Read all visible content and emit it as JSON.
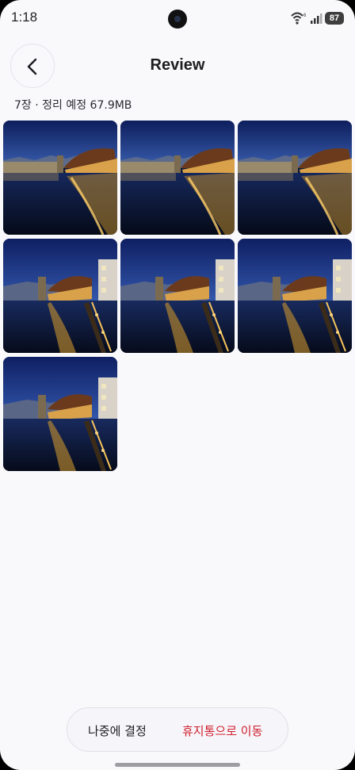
{
  "status_bar": {
    "time": "1:18",
    "battery": "87"
  },
  "header": {
    "back_label": "Back",
    "title": "Review"
  },
  "summary": "7장 · 정리 예정 67.9MB",
  "photos": [
    {
      "variant": "a"
    },
    {
      "variant": "a"
    },
    {
      "variant": "a"
    },
    {
      "variant": "b"
    },
    {
      "variant": "b"
    },
    {
      "variant": "b"
    },
    {
      "variant": "b"
    }
  ],
  "actions": {
    "later": "나중에 결정",
    "move_to_trash": "휴지통으로 이동"
  },
  "colors": {
    "accent_danger": "#d0202f",
    "background": "#f9f8fb"
  }
}
